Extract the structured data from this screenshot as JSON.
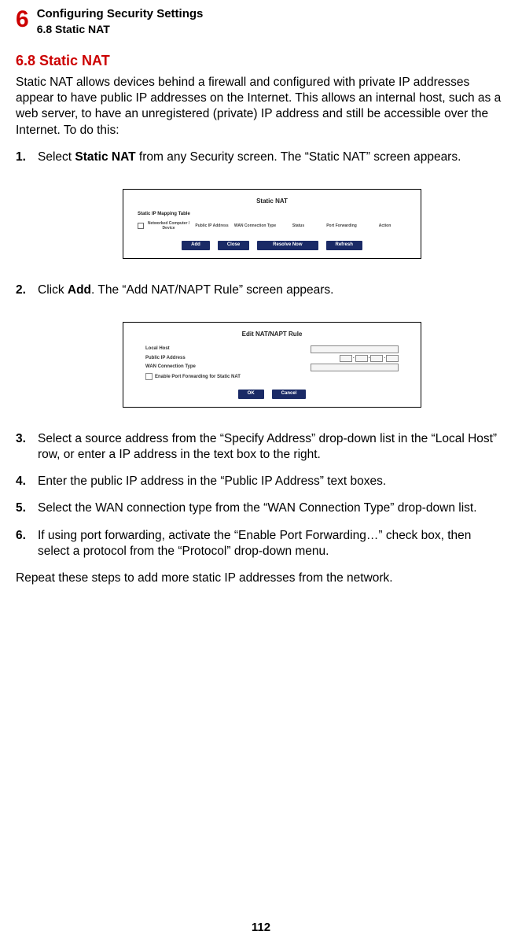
{
  "header": {
    "chapter_number": "6",
    "chapter_title": "Configuring Security Settings",
    "chapter_sub": "6.8  Static NAT"
  },
  "section": {
    "heading": "6.8  Static NAT",
    "intro": "Static NAT allows devices behind a firewall and configured with private IP addresses appear to have public IP addresses on the Internet. This allows an internal host, such as a web server, to have an unregistered (private) IP address and still be accessible over the Internet. To do this:"
  },
  "steps": {
    "s1_a": "Select ",
    "s1_bold": "Static NAT",
    "s1_b": " from any Security screen. The “Static NAT” screen appears.",
    "s2_a": "Click ",
    "s2_bold": "Add",
    "s2_b": ". The “Add NAT/NAPT Rule” screen appears.",
    "s3": "Select a source address from the “Specify Address” drop-down list in the “Local Host” row, or enter a IP address in the text box to the right.",
    "s4": "Enter the public IP address in the “Public IP Address” text boxes.",
    "s5": "Select the WAN connection type from the “WAN Connection Type” drop-down list.",
    "s6": "If using port forwarding, activate the “Enable Port Forwarding…” check box, then select a protocol from the “Protocol” drop-down menu."
  },
  "closing": "Repeat these steps to add more static IP addresses from the network.",
  "page_number": "112",
  "figure1": {
    "title": "Static NAT",
    "subhead": "Static IP Mapping Table",
    "cols": [
      "",
      "Networked Computer / Device",
      "Public IP Address",
      "WAN Connection Type",
      "Status",
      "Port Forwarding",
      "Action"
    ],
    "buttons": [
      "Add",
      "Close",
      "Resolve Now",
      "Refresh"
    ]
  },
  "figure2": {
    "title": "Edit NAT/NAPT Rule",
    "rows": {
      "r1": "Local Host",
      "r2": "Public IP Address",
      "r3": "WAN Connection Type",
      "r4": "Enable Port Forwarding for Static NAT"
    },
    "buttons": [
      "OK",
      "Cancel"
    ]
  }
}
